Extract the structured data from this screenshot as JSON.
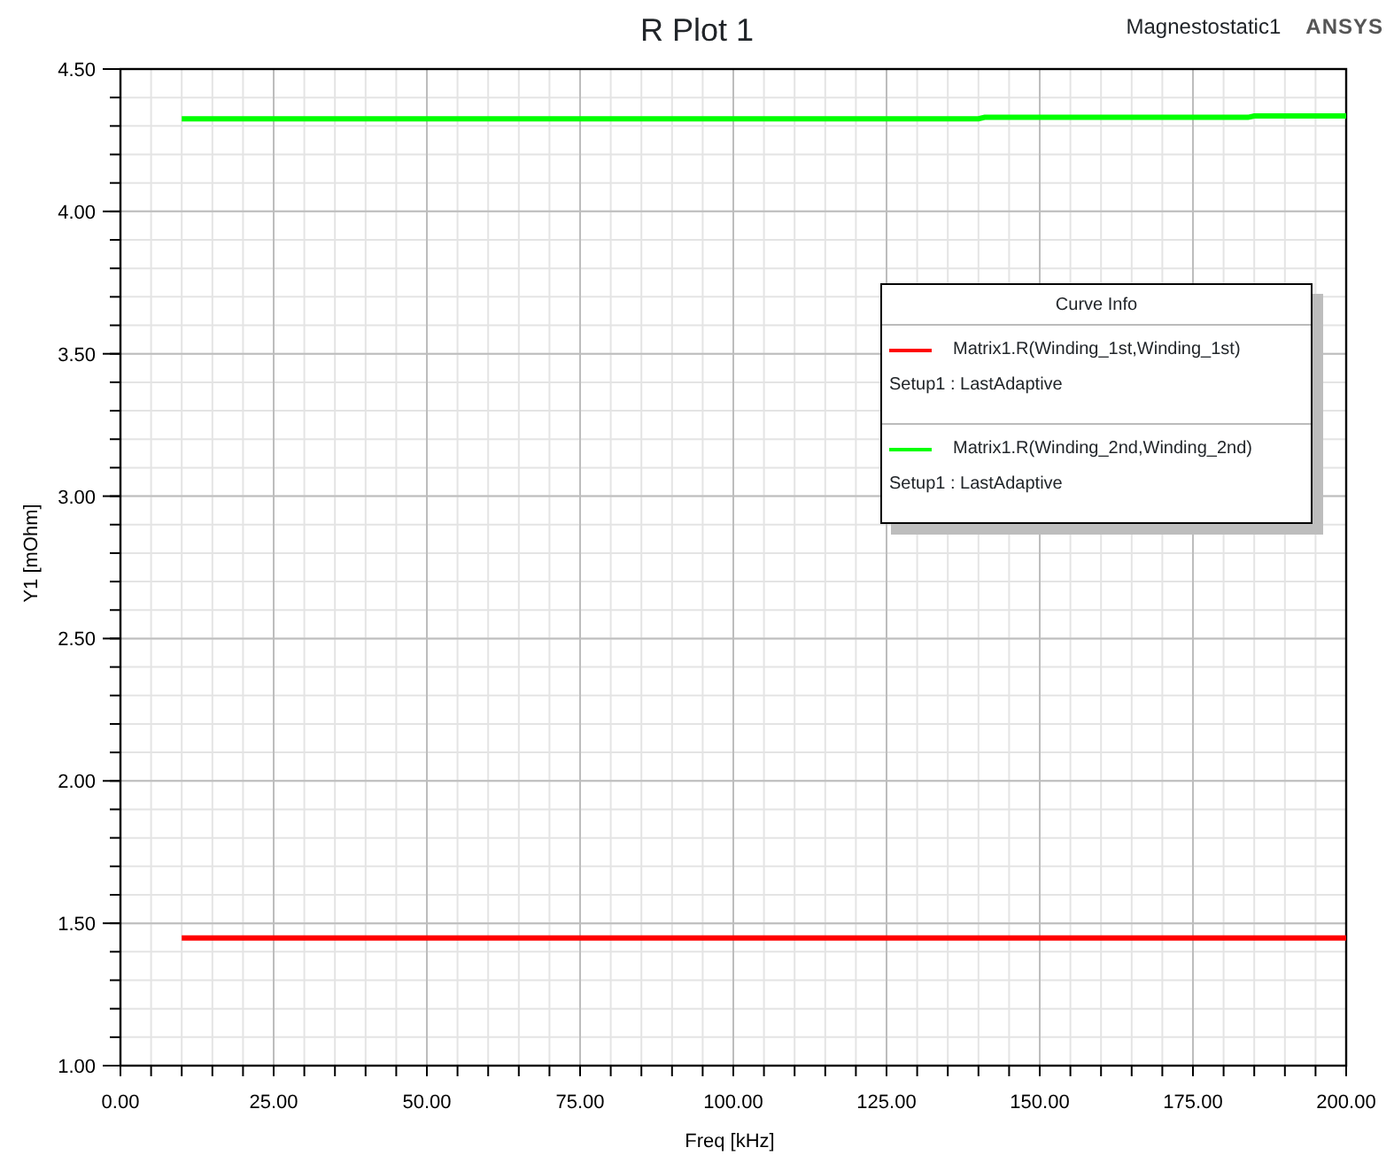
{
  "title": "R Plot 1",
  "design": "Magnestostatic1",
  "brand": "ANSYS",
  "chart_data": {
    "type": "line",
    "xlabel": "Freq [kHz]",
    "ylabel": "Y1 [mOhm]",
    "x": [
      10,
      140,
      141,
      184,
      185,
      200
    ],
    "series": [
      {
        "name": "Matrix1.R(Winding_1st,Winding_1st)",
        "color": "#ff0000",
        "values": [
          1.448,
          1.448,
          1.448,
          1.448,
          1.448,
          1.448
        ]
      },
      {
        "name": "Matrix1.R(Winding_2nd,Winding_2nd)",
        "color": "#00ff00",
        "values": [
          4.325,
          4.325,
          4.33,
          4.33,
          4.335,
          4.335
        ]
      }
    ],
    "grid": true,
    "xlim": [
      0,
      200
    ],
    "ylim": [
      1,
      4.5
    ],
    "xticks": [
      {
        "value": 0,
        "label": "0.00"
      },
      {
        "value": 25,
        "label": "25.00"
      },
      {
        "value": 50,
        "label": "50.00"
      },
      {
        "value": 75,
        "label": "75.00"
      },
      {
        "value": 100,
        "label": "100.00"
      },
      {
        "value": 125,
        "label": "125.00"
      },
      {
        "value": 150,
        "label": "150.00"
      },
      {
        "value": 175,
        "label": "175.00"
      },
      {
        "value": 200,
        "label": "200.00"
      }
    ],
    "yticks": [
      {
        "value": 1,
        "label": "1.00"
      },
      {
        "value": 1.5,
        "label": "1.50"
      },
      {
        "value": 2,
        "label": "2.00"
      },
      {
        "value": 2.5,
        "label": "2.50"
      },
      {
        "value": 3,
        "label": "3.00"
      },
      {
        "value": 3.5,
        "label": "3.50"
      },
      {
        "value": 4,
        "label": "4.00"
      },
      {
        "value": 4.5,
        "label": "4.50"
      }
    ]
  },
  "legend": {
    "title": "Curve Info",
    "entries": [
      {
        "source": "Setup1 : LastAdaptive"
      },
      {
        "source": "Setup1 : LastAdaptive"
      }
    ]
  }
}
